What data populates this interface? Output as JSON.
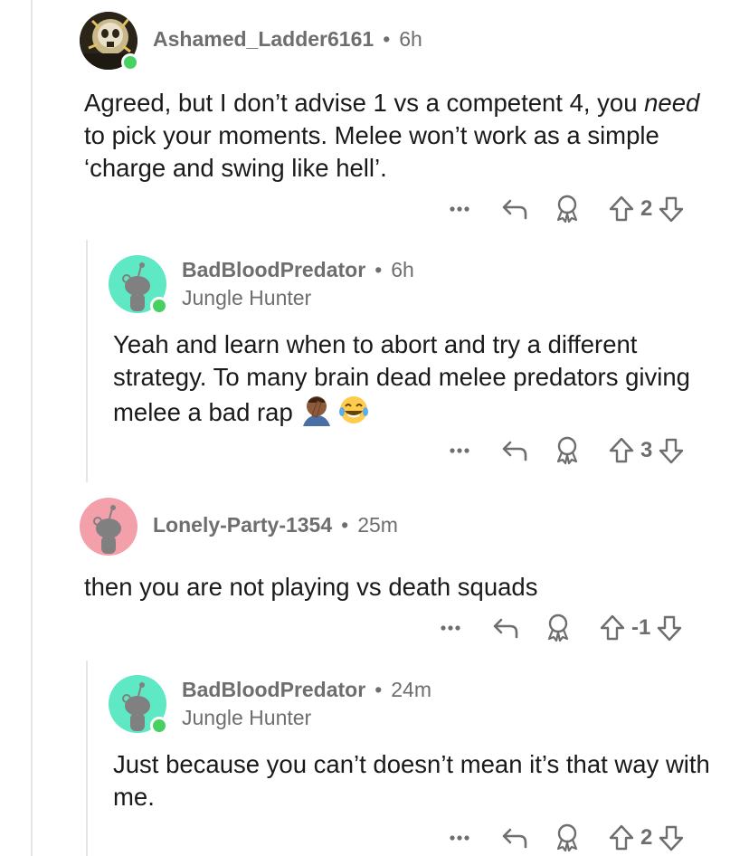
{
  "comments": [
    {
      "username": "Ashamed_Ladder6161",
      "separator": "•",
      "age": "6h",
      "flair": "",
      "body_pre": "Agreed, but I don’t advise 1 vs a competent 4, you ",
      "body_em": "need",
      "body_post": " to pick your moments. Melee won’t work as a simple ‘charge and swing like hell’.",
      "score": "2",
      "avatar": "custom-skull-avatar",
      "online": true
    },
    {
      "username": "BadBloodPredator",
      "separator": "•",
      "age": "6h",
      "flair": "Jungle Hunter",
      "body": "Yeah and learn when to abort and try a different strategy. To many brain dead melee predators giving melee a bad rap",
      "emojis": [
        "facepalm-emoji",
        "laughing-tears-emoji"
      ],
      "score": "3",
      "avatar": "snoo-avatar",
      "avatar_color": "#5ee8c4",
      "online": true
    },
    {
      "username": "Lonely-Party-1354",
      "separator": "•",
      "age": "25m",
      "flair": "",
      "body": "then you are not playing vs death squads",
      "score": "-1",
      "avatar": "snoo-avatar",
      "avatar_color": "#f3a0aa",
      "online": false
    },
    {
      "username": "BadBloodPredator",
      "separator": "•",
      "age": "24m",
      "flair": "Jungle Hunter",
      "body": "Just because you can’t doesn’t mean it’s that way with me.",
      "score": "2",
      "avatar": "snoo-avatar",
      "avatar_color": "#5ee8c4",
      "online": true
    }
  ],
  "icons": {
    "more": "more-options-icon",
    "reply": "reply-icon",
    "award": "award-icon",
    "upvote": "upvote-icon",
    "downvote": "downvote-icon"
  },
  "colors": {
    "text": "#1a1a1b",
    "meta": "#6e6e6e",
    "online": "#46d160",
    "rule": "#e5e5e5"
  }
}
